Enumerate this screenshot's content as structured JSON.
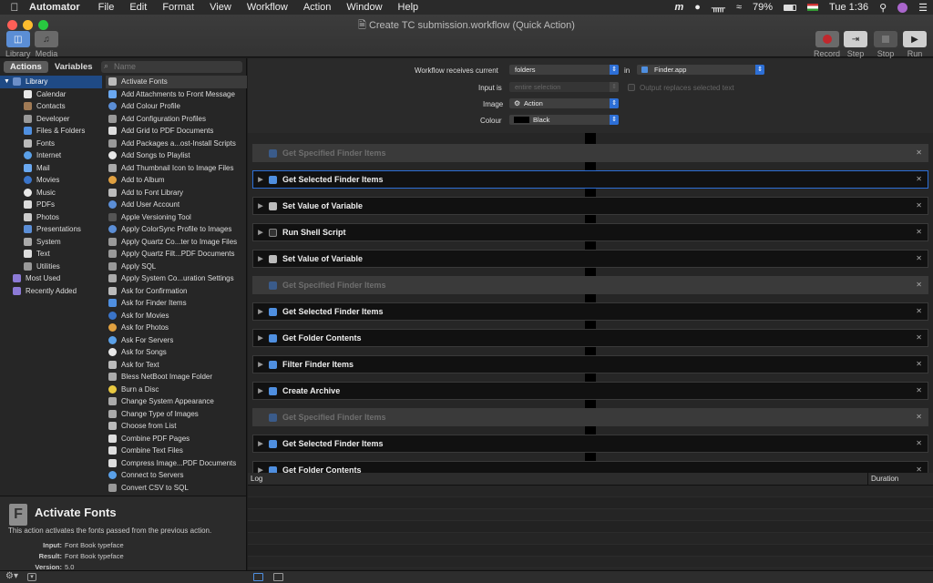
{
  "menubar": {
    "app": "Automator",
    "items": [
      "File",
      "Edit",
      "Format",
      "View",
      "Workflow",
      "Action",
      "Window",
      "Help"
    ],
    "battery": "79%",
    "clock": "Tue 1:36"
  },
  "window": {
    "title": "Create TC submission.workflow (Quick Action)"
  },
  "toolbar": {
    "library": "Library",
    "media": "Media",
    "record": "Record",
    "step": "Step",
    "stop": "Stop",
    "run": "Run"
  },
  "sidebar": {
    "tab_actions": "Actions",
    "tab_variables": "Variables",
    "search_placeholder": "Name",
    "library": "Library",
    "categories": [
      "Calendar",
      "Contacts",
      "Developer",
      "Files & Folders",
      "Fonts",
      "Internet",
      "Mail",
      "Movies",
      "Music",
      "PDFs",
      "Photos",
      "Presentations",
      "System",
      "Text",
      "Utilities"
    ],
    "most_used": "Most Used",
    "recently_added": "Recently Added"
  },
  "actions": [
    "Activate Fonts",
    "Add Attachments to Front Message",
    "Add Colour Profile",
    "Add Configuration Profiles",
    "Add Grid to PDF Documents",
    "Add Packages a...ost-Install Scripts",
    "Add Songs to Playlist",
    "Add Thumbnail Icon to Image Files",
    "Add to Album",
    "Add to Font Library",
    "Add User Account",
    "Apple Versioning Tool",
    "Apply ColorSync Profile to Images",
    "Apply Quartz Co...ter to Image Files",
    "Apply Quartz Filt...PDF Documents",
    "Apply SQL",
    "Apply System Co...uration Settings",
    "Ask for Confirmation",
    "Ask for Finder Items",
    "Ask for Movies",
    "Ask for Photos",
    "Ask For Servers",
    "Ask for Songs",
    "Ask for Text",
    "Bless NetBoot Image Folder",
    "Burn a Disc",
    "Change System Appearance",
    "Change Type of Images",
    "Choose from List",
    "Combine PDF Pages",
    "Combine Text Files",
    "Compress Image...PDF Documents",
    "Connect to Servers",
    "Convert CSV to SQL"
  ],
  "description": {
    "title": "Activate Fonts",
    "text": "This action activates the fonts passed from the previous action.",
    "input_label": "Input:",
    "input": "Font Book typeface",
    "result_label": "Result:",
    "result": "Font Book typeface",
    "version_label": "Version:",
    "version": "5.0"
  },
  "workflow": {
    "receives_label": "Workflow receives current",
    "receives": "folders",
    "in_label": "in",
    "in_app": "Finder.app",
    "input_is_label": "Input is",
    "input_is": "entire selection",
    "replaces": "Output replaces selected text",
    "image_label": "Image",
    "image": "Action",
    "colour_label": "Colour",
    "colour": "Black"
  },
  "steps": [
    "Get Specified Finder Items",
    "Get Selected Finder Items",
    "Set Value of Variable",
    "Run Shell Script",
    "Set Value of Variable",
    "Get Specified Finder Items",
    "Get Selected Finder Items",
    "Get Folder Contents",
    "Filter Finder Items",
    "Create Archive",
    "Get Specified Finder Items",
    "Get Selected Finder Items",
    "Get Folder Contents"
  ],
  "log": {
    "log_label": "Log",
    "duration_label": "Duration"
  }
}
